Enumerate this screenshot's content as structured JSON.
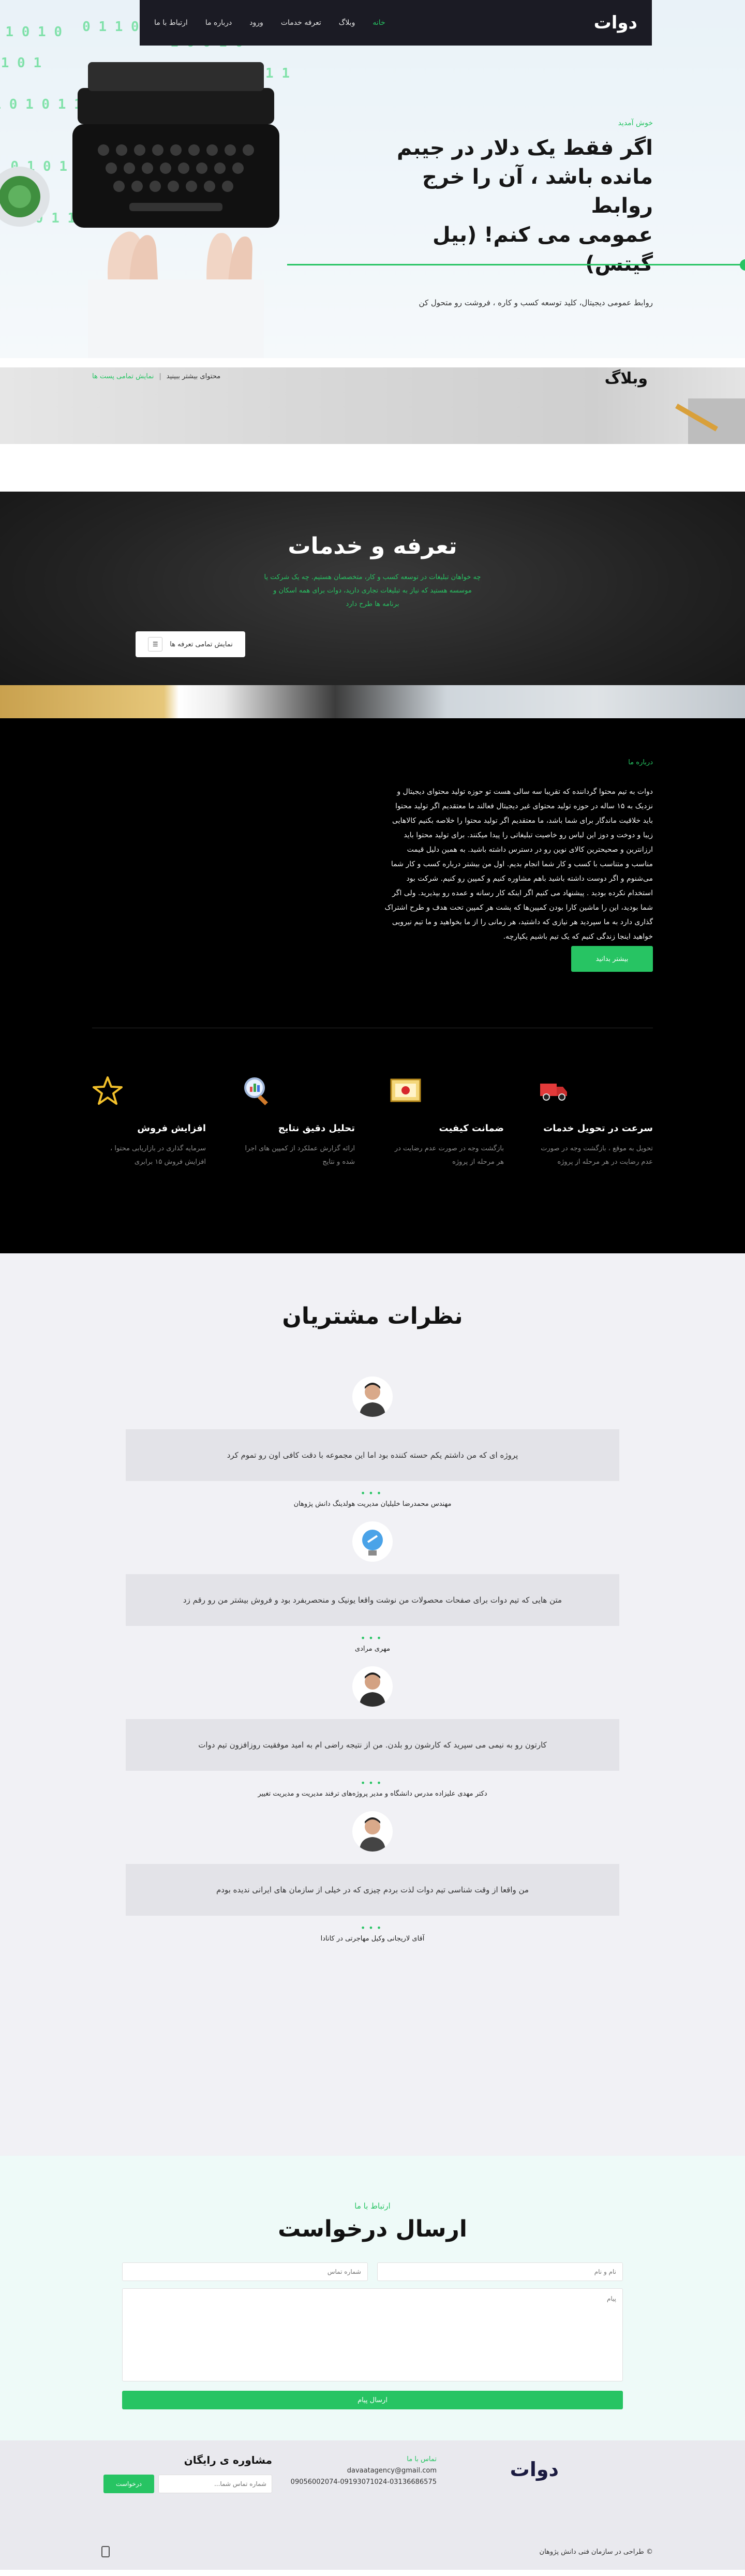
{
  "nav": {
    "items": [
      "خانه",
      "وبلاگ",
      "تعرفه خدمات",
      "ورود",
      "درباره ما",
      "ارتباط با ما"
    ],
    "logo_text": "دوات"
  },
  "hero": {
    "subtitle": "خوش آمدید",
    "title_line1": "اگر فقط یک دلار در جیبم",
    "title_line2": "مانده باشد ، آن را خرج روابط",
    "title_line3": "عمومی می کنم! (بیل گیتس)",
    "description": "روابط عمومی دیجیتال، کلید توسعه کسب و کاره ، فروشت رو متحول کن"
  },
  "blog": {
    "title": "وبلاگ",
    "view_more": "محتوای بیشتر ببینید",
    "separator": "|",
    "show_all": "نمایش تمامی پست ها"
  },
  "tariff": {
    "title": "تعرفه و خدمات",
    "description": "چه خواهان تبلیغات در توسعه کسب و کار، متخصصان هستیم. چه یک شرکت یا موسسه هستید که نیاز به تبلیغات تجاری دارید، دوات برای همه اسکان و برنامه ها طرح دارد",
    "button_label": "نمایش تمامی تعرفه ها"
  },
  "about": {
    "subtitle": "درباره ما",
    "text": "دوات به تیم محتوا گرداننده که تقریبا سه سالی هست تو حوزه تولید محتوای دیجیتال و نزدیک به ۱۵ ساله در حوزه تولید محتوای غیر دیجیتال فعالند ما معتقدیم اگر تولید محتوا باید خلاقیت ماندگار برای شما باشد، ما معتقدیم اگر تولید محتوا را خلاصه بکنیم کالاهایی زیبا و دوخت و دوز این لباس رو خاصیت تبلیغاتی را پیدا میکنند. برای تولید محتوا باید ارزانترین و صحیحترین کالای نوین رو در دسترس داشته باشید. به همین دلیل قیمت مناسب و متناسب با کسب و کار شما انجام بدیم. اول من بیشتر درباره کسب و کار شما می‌شنوم و اگر دوست داشته باشید باهم مشاوره کنیم و کمپین رو کنیم. شرکت بود استخدام نکرده بودید . پیشنهاد می کنیم اگر اینکه کار رسانه و عمده رو بپذیرید. ولی اگر شما بودید، این را ماشین کارا بودن کمپین‌ها که پشت هر کمپین تحت هدف و طرح اشتراک گذاری دارد به ما سپردید هر نیازی که داشتید، هر زمانی را از ما بخواهید و ما تیم نیرویی خواهید اینجا زندگی کنیم که یک تیم باشیم یکپارچه.",
    "button_label": "بیشتر بدانید",
    "features": [
      {
        "title": "افزایش فروش",
        "desc": "سرمایه گذاری در بازاریابی محتوا ، افزایش فروش ۱۵ برابری"
      },
      {
        "title": "تحلیل دقیق نتایج",
        "desc": "ارائه گزارش عملکرد از کمپین های اجرا شده و نتایج"
      },
      {
        "title": "ضمانت کیفیت",
        "desc": "بازگشت وجه در صورت عدم رضایت در هر مرحله از پروژه"
      },
      {
        "title": "سرعت در تحویل خدمات",
        "desc": "تحویل به موقع ، بازگشت وجه در صورت عدم رضایت در هر مرحله از پروژه"
      }
    ]
  },
  "testimonials": {
    "title": "نظرات مشتریان",
    "items": [
      {
        "quote": "پروژه ای که من داشتم یکم حسته کننده بود اما این مجموعه با دقت کافی اون رو تموم کرد",
        "author": "مهندس محمدرضا خلیلیان مدیریت هولدینگ دانش پژوهان"
      },
      {
        "quote": "متن هایی که تیم دوات برای صفحات محصولات من نوشت واقعا یونیک و منحصربفرد بود و فروش بیشتر من رو رقم زد",
        "author": "مهری مرادی"
      },
      {
        "quote": "کارتون رو به نیمی می سپرید که کارشون رو بلدن. من از نتیجه راضی ام به امید موفقیت روزافزون تیم دوات",
        "author": "دکتر مهدی علیزاده مدرس دانشگاه و مدیر پروژه‌های ترفند مدیریت و مدیریت تغییر"
      },
      {
        "quote": "من واقعا از وقت شناسی تیم دوات لذت بردم چیزی که در خیلی از سازمان های ایرانی ندیده بودم",
        "author": "آقای لاریجانی وکیل مهاجرتی در کانادا"
      }
    ]
  },
  "contact": {
    "subtitle": "ارتباط با ما",
    "title": "ارسال درخواست",
    "name_placeholder": "نام و نام",
    "phone_placeholder": "شماره تماس",
    "message_placeholder": "پیام",
    "submit_label": "ارسال پیام"
  },
  "footer": {
    "contact_label": "تماس با ما",
    "email": "davaatagency@gmail.com",
    "phones": "09056002074-09193071024-03136686575",
    "consult_title": "مشاوره ی رایگان",
    "consult_placeholder": "شماره تماس شما...",
    "consult_button": "درخواست",
    "copyright": "© طراحی در سازمان فنی دانش پژوهان"
  },
  "colors": {
    "accent": "#27c463",
    "nav_bg": "#1b1b24",
    "dark_bg": "#000000",
    "testimonial_bg": "#f1f1f5",
    "contact_bg": "#eefaf8"
  }
}
